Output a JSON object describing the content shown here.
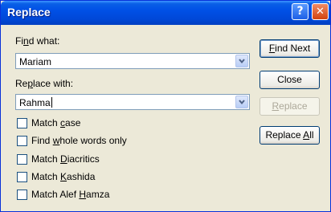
{
  "window": {
    "title": "Replace",
    "help_icon": "?",
    "close_icon": "✕"
  },
  "find": {
    "label_pre": "Fi",
    "label_key": "n",
    "label_post": "d what:",
    "value": "Mariam"
  },
  "replace": {
    "label_pre": "Re",
    "label_key": "p",
    "label_post": "lace with:",
    "value": "Rahma"
  },
  "options": [
    {
      "pre": "Match ",
      "key": "c",
      "post": "ase",
      "checked": false
    },
    {
      "pre": "Find ",
      "key": "w",
      "post": "hole words only",
      "checked": false
    },
    {
      "pre": "Match ",
      "key": "D",
      "post": "iacritics",
      "checked": false
    },
    {
      "pre": "Match ",
      "key": "K",
      "post": "ashida",
      "checked": false
    },
    {
      "pre": "Match Alef ",
      "key": "H",
      "post": "amza",
      "checked": false
    }
  ],
  "buttons": {
    "find_next": {
      "pre": "",
      "key": "F",
      "post": "ind Next"
    },
    "close": {
      "label": "Close"
    },
    "replace": {
      "pre": "",
      "key": "R",
      "post": "eplace",
      "enabled": false
    },
    "replace_all": {
      "pre": "Replace ",
      "key": "A",
      "post": "ll"
    }
  }
}
